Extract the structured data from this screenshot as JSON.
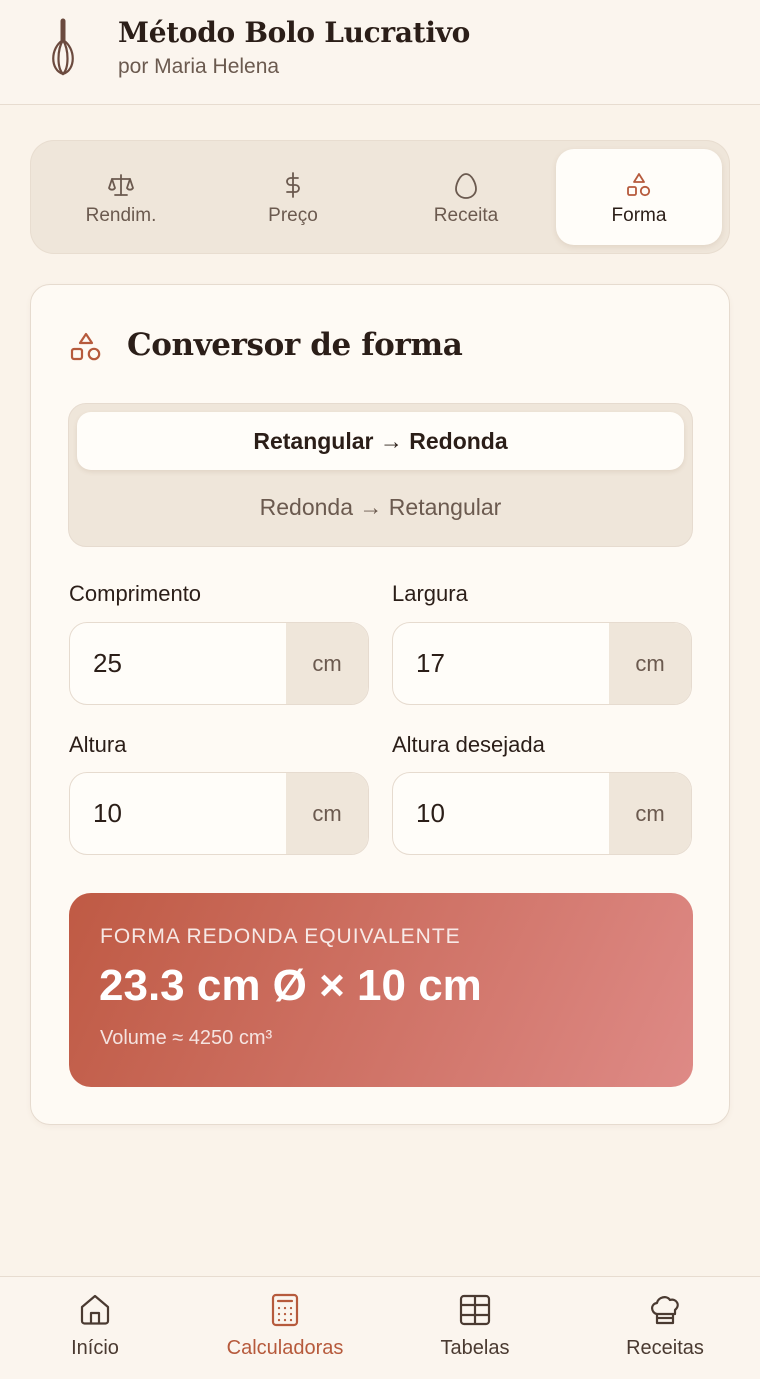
{
  "header": {
    "title": "Método Bolo Lucrativo",
    "subtitle": "por Maria Helena",
    "logo_icon": "whisk-icon"
  },
  "tabs": [
    {
      "label": "Rendim.",
      "icon": "scale-icon",
      "active": false
    },
    {
      "label": "Preço",
      "icon": "dollar-icon",
      "active": false
    },
    {
      "label": "Receita",
      "icon": "egg-icon",
      "active": false
    },
    {
      "label": "Forma",
      "icon": "shapes-icon",
      "active": true
    }
  ],
  "card": {
    "title": "Conversor de forma",
    "title_icon": "shapes-icon",
    "mode_options": [
      {
        "label": "Retangular → Redonda",
        "selected": true
      },
      {
        "label": "Redonda → Retangular",
        "selected": false
      }
    ],
    "fields": [
      {
        "label": "Comprimento",
        "value": "25",
        "unit": "cm"
      },
      {
        "label": "Largura",
        "value": "17",
        "unit": "cm"
      },
      {
        "label": "Altura",
        "value": "10",
        "unit": "cm"
      },
      {
        "label": "Altura desejada",
        "value": "10",
        "unit": "cm"
      }
    ],
    "result": {
      "label": "FORMA REDONDA EQUIVALENTE",
      "value": "23.3 cm Ø × 10 cm",
      "volume": "Volume ≈ 4250 cm³"
    }
  },
  "bottom_nav": [
    {
      "label": "Início",
      "icon": "home-icon",
      "active": false
    },
    {
      "label": "Calculadoras",
      "icon": "calculator-icon",
      "active": true
    },
    {
      "label": "Tabelas",
      "icon": "table-icon",
      "active": false
    },
    {
      "label": "Receitas",
      "icon": "chef-hat-icon",
      "active": false
    }
  ],
  "colors": {
    "accent": "#b65a3c",
    "background": "#faf3ea",
    "result_gradient_start": "#bf5a44",
    "result_gradient_end": "#de8a86"
  }
}
